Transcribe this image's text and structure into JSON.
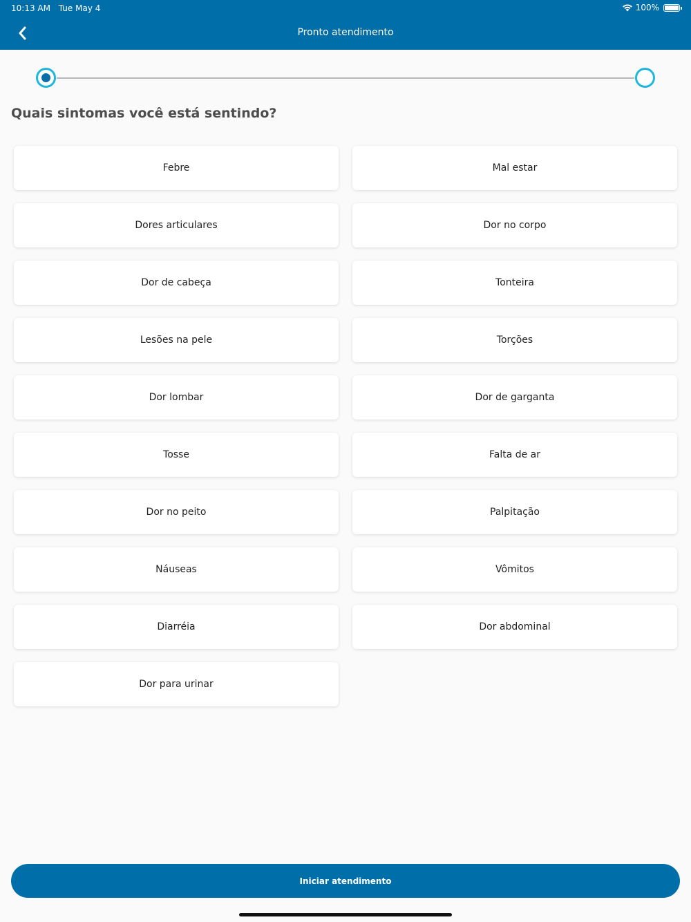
{
  "status_bar": {
    "time": "10:13 AM",
    "date": "Tue May 4",
    "battery": "100%"
  },
  "header": {
    "title": "Pronto atendimento",
    "back_icon": "chevron-left-icon"
  },
  "stepper": {
    "current_step": 1,
    "total_steps": 2,
    "accent_color": "#1fb6dc"
  },
  "question": "Quais sintomas você está sentindo?",
  "symptoms": [
    "Febre",
    "Mal estar",
    "Dores articulares",
    "Dor no corpo",
    "Dor de cabeça",
    "Tonteira",
    "Lesões na pele",
    "Torções",
    "Dor lombar",
    "Dor de garganta",
    "Tosse",
    "Falta de ar",
    "Dor no peito",
    "Palpitação",
    "Náuseas",
    "Vômitos",
    "Diarréia",
    "Dor abdominal",
    "Dor para urinar"
  ],
  "start_button": "Iniciar atendimento",
  "colors": {
    "brand": "#006ea8",
    "background": "#fafafa"
  }
}
